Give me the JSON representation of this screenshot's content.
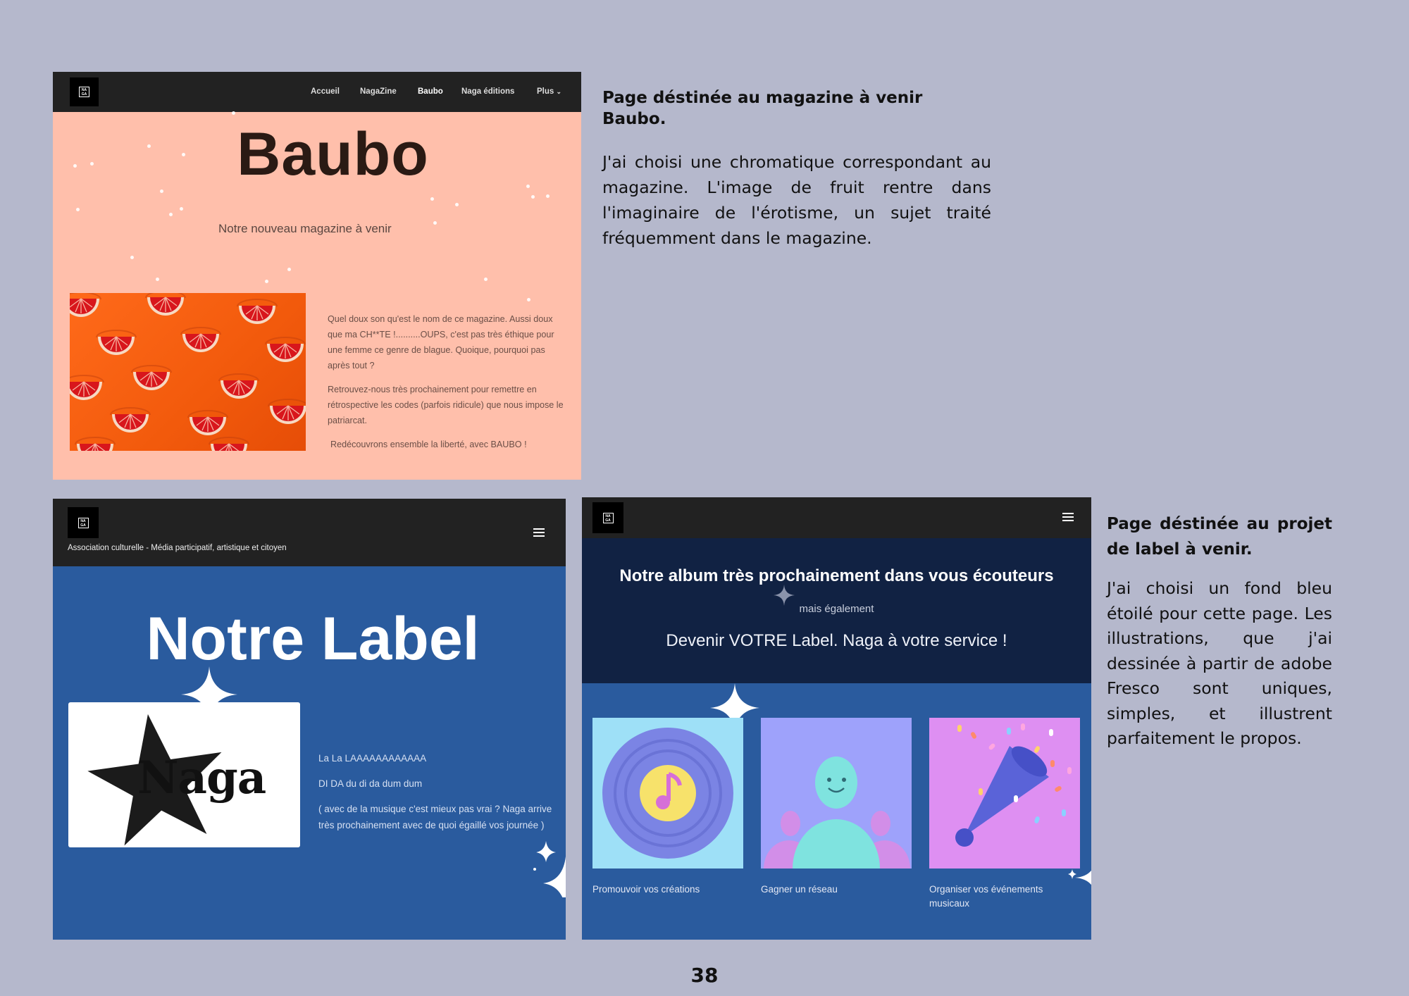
{
  "page_number": "38",
  "baubo": {
    "nav": {
      "logo": "NA GA",
      "items": [
        "Accueil",
        "NagaZine",
        "Baubo",
        "Naga éditions",
        "Plus"
      ],
      "active": "Baubo"
    },
    "title": "Baubo",
    "subtitle": "Notre nouveau magazine à venir",
    "image_alt": "grapefruit slices on orange background",
    "paragraphs": [
      "Quel doux son qu'est le nom de ce magazine. Aussi doux que ma CH**TE !..........OUPS, c'est pas très éthique pour une femme ce genre de blague. Quoique, pourquoi pas après tout ?",
      "Retrouvez-nous très prochainement pour remettre en rétrospective les codes (parfois ridicule) que nous impose le patriarcat.",
      "Redécouvrons ensemble la liberté, avec BAUBO !"
    ],
    "colors": {
      "bg": "#ffbfab",
      "nav": "#222222",
      "title": "#2a1a14"
    }
  },
  "baubo_desc": {
    "heading": "Page déstinée au magazine à venir Baubo.",
    "body": "J'ai choisi une chromatique correspondant au magazine. L'image de fruit rentre dans l'imaginaire de l'érotisme, un sujet traité fréquemment dans le magazine."
  },
  "label_left": {
    "logo": "NA GA",
    "tagline": "Association culturelle - Média participatif, artistique et citoyen",
    "title": "Notre Label",
    "naga_logo_text": "Naga",
    "lines": [
      "La La LAAAAAAAAAAAA",
      "DI DA du di da dum dum",
      "( avec de la musique c'est mieux pas vrai ? Naga arrive très prochainement avec de quoi égaillé vos journée )"
    ],
    "colors": {
      "bg": "#2a5b9e",
      "nav": "#222222"
    }
  },
  "label_right": {
    "logo": "NA GA",
    "heading": "Notre album très prochainement dans vous écouteurs",
    "small": "mais également",
    "sub": "Devenir VOTRE Label. Naga à votre service !",
    "tiles": [
      {
        "caption": "Promouvoir vos créations",
        "icon": "vinyl-record-icon"
      },
      {
        "caption": "Gagner un réseau",
        "icon": "people-network-icon"
      },
      {
        "caption": "Organiser vos événements musicaux",
        "icon": "party-popper-icon"
      }
    ],
    "colors": {
      "top": "#112243",
      "bottom": "#2a5b9e"
    }
  },
  "label_desc": {
    "heading": "Page déstinée au projet de label à venir.",
    "body": "J'ai choisi un fond bleu étoilé pour cette page. Les illustrations, que j'ai dessinée à partir de adobe Fresco sont uniques, simples, et illustrent parfaitement le propos."
  }
}
